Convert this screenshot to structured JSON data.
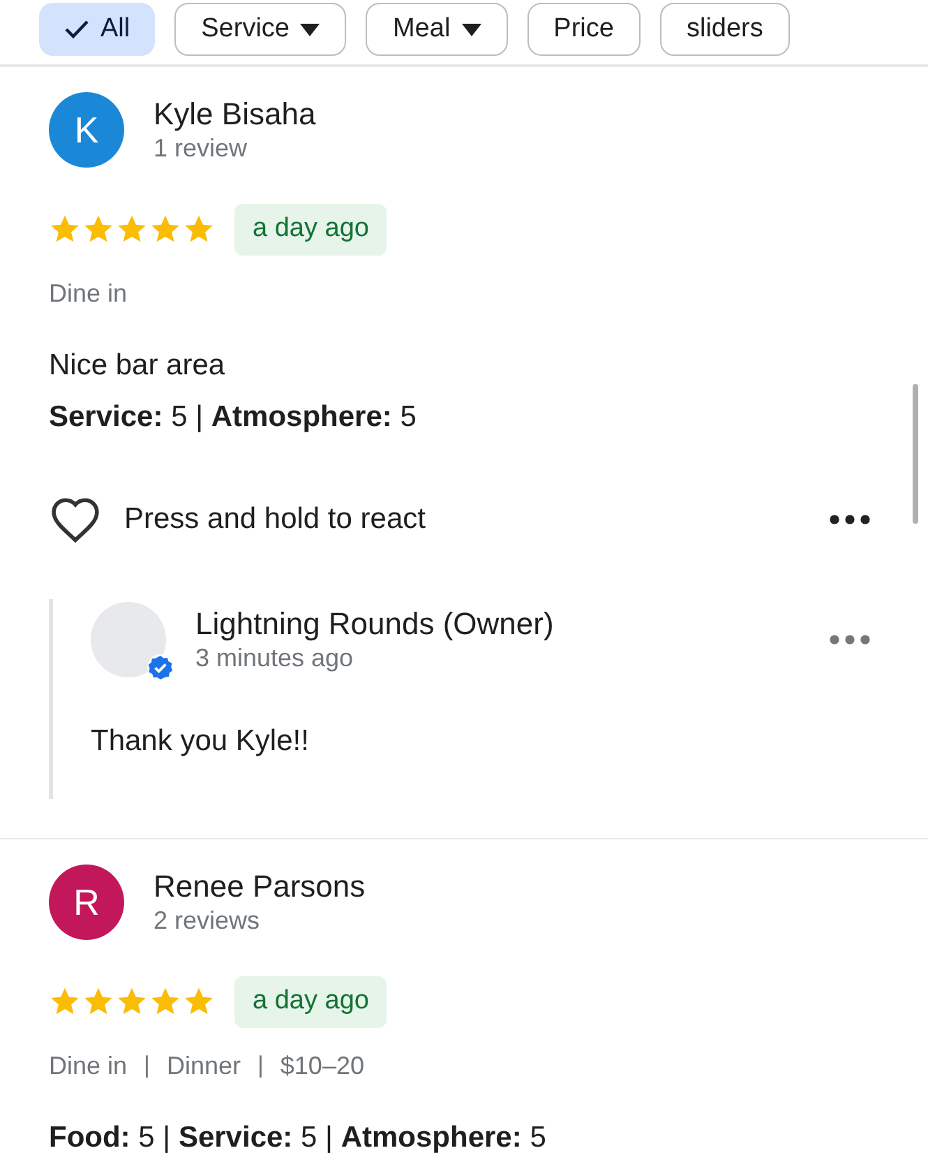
{
  "filters": [
    {
      "label": "All",
      "selected": true,
      "dropdown": false
    },
    {
      "label": "Service",
      "selected": false,
      "dropdown": true
    },
    {
      "label": "Meal",
      "selected": false,
      "dropdown": true
    },
    {
      "label": "Price",
      "selected": false,
      "dropdown": false
    },
    {
      "label": "sliders",
      "selected": false,
      "dropdown": false
    }
  ],
  "reviews": [
    {
      "initial": "K",
      "color": "#1a88d6",
      "name": "Kyle Bisaha",
      "count": "1 review",
      "stars": 5,
      "time": "a day ago",
      "meta": [
        "Dine in"
      ],
      "lines": [
        "Nice bar area",
        "**Service:** 5 | **Atmosphere:** 5"
      ],
      "react": "Press and hold to react",
      "reply": {
        "name": "Lightning Rounds (Owner)",
        "time": "3 minutes ago",
        "text": "Thank you Kyle!!"
      }
    },
    {
      "initial": "R",
      "color": "#c2185b",
      "name": "Renee Parsons",
      "count": "2 reviews",
      "stars": 5,
      "time": "a day ago",
      "separator": "|",
      "meta": [
        "Dine in",
        "Dinner",
        "$10–20"
      ],
      "lines": [
        "**Food:** 5 | **Service:** 5 | **Atmosphere:** 5"
      ]
    }
  ]
}
